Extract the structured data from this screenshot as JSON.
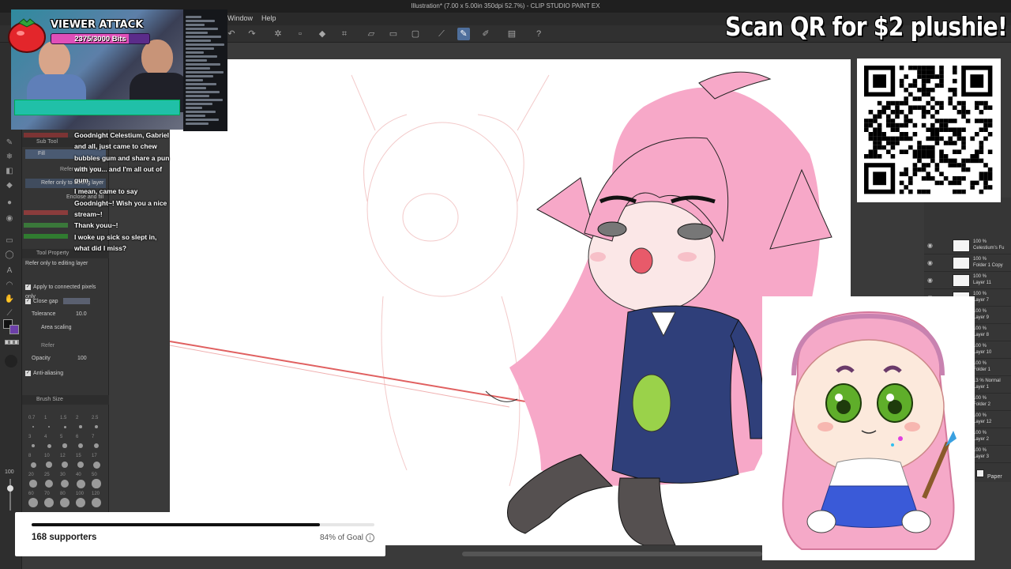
{
  "app": {
    "title": "Illustration* (7.00 x 5.00in 350dpi 52.7%) - CLIP STUDIO PAINT EX",
    "menu": [
      "Window",
      "Help"
    ]
  },
  "tool_panel": {
    "subtool_header": "Sub Tool",
    "fill_label": "Fill",
    "refer_editing": "Refer only to editing layer",
    "enclose_fill": "Enclose and fill",
    "refer_other": "Refer other layer",
    "property_header": "Tool Property",
    "property_title": "Refer only to editing layer",
    "apply_connected": "Apply to connected pixels only",
    "close_gap": "Close gap",
    "tolerance_label": "Tolerance",
    "tolerance_value": "10.0",
    "area_scaling": "Area scaling",
    "refer_label": "Refer",
    "opacity_label": "Opacity",
    "opacity_value": "100",
    "anti_aliasing": "Anti-aliasing",
    "brush_size_header": "Brush Size",
    "brush_sizes": [
      "0.7",
      "1",
      "1.5",
      "2",
      "2.5",
      "3",
      "4",
      "5",
      "6",
      "7",
      "8",
      "10",
      "12",
      "15",
      "17",
      "20",
      "25",
      "30",
      "40",
      "50",
      "60",
      "70",
      "80",
      "100",
      "120"
    ],
    "zoom_value": "100"
  },
  "chat": [
    {
      "user": "",
      "text": "Goodnight Celestium, Gabriel and all, just came to chew bubbles gum and share a pun with you... and I'm all out of gum"
    },
    {
      "user": "",
      "text": "I mean, came to say Goodnight~! Wish you a nice stream~!"
    },
    {
      "user": "",
      "text": "Thank youu~!"
    },
    {
      "user": "",
      "text": "I woke up sick so slept in, what did I miss?"
    }
  ],
  "viewer_attack": {
    "title": "VIEWER ATTACK",
    "progress_text": "2375/3000 Bits",
    "fraction": 0.79
  },
  "promo": {
    "text": "Scan QR for $2 plushie!"
  },
  "goal": {
    "supporters": "168 supporters",
    "percent_text": "84% of Goal",
    "fraction": 0.84
  },
  "layers": [
    {
      "opacity": "100 %",
      "name": "Celestium's Fu"
    },
    {
      "opacity": "100 %",
      "name": "Folder 1 Copy"
    },
    {
      "opacity": "100 %",
      "name": "Layer 11"
    },
    {
      "opacity": "100 %",
      "name": "Layer 7"
    },
    {
      "opacity": "100 %",
      "name": "Layer 9"
    },
    {
      "opacity": "100 %",
      "name": "Layer 8"
    },
    {
      "opacity": "100 %",
      "name": "Layer 10"
    },
    {
      "opacity": "100 %",
      "name": "Folder 1"
    },
    {
      "opacity": "13 % Normal",
      "name": "Layer 1"
    },
    {
      "opacity": "100 %",
      "name": "Folder 2"
    },
    {
      "opacity": "100 %",
      "name": "Layer 12"
    },
    {
      "opacity": "100 %",
      "name": "Layer 2"
    },
    {
      "opacity": "100 %",
      "name": "Layer 3"
    }
  ],
  "paper_label": "Paper",
  "colors": {
    "accent": "#4f6f9c",
    "hair": "#f5a3c4",
    "jacket": "#2f3f7a",
    "badge_fill": "#e04fb8"
  }
}
